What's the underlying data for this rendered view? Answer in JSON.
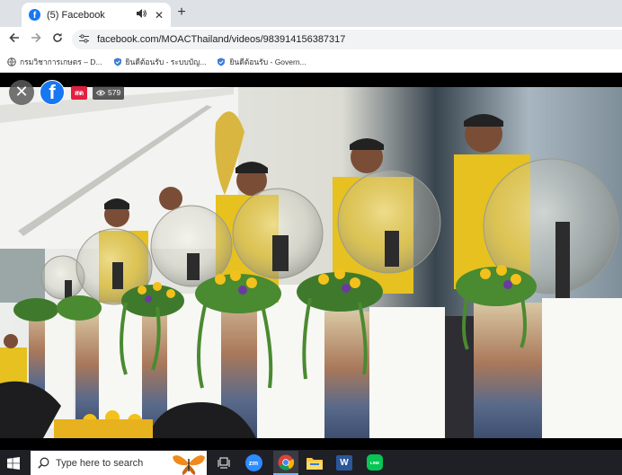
{
  "browser": {
    "tab": {
      "favicon": "facebook-icon",
      "title": "(5) Facebook",
      "audio_icon": "speaker-icon",
      "close_icon": "close-icon"
    },
    "new_tab_icon": "plus-icon",
    "nav": {
      "back_icon": "arrow-left-icon",
      "forward_icon": "arrow-right-icon",
      "reload_icon": "reload-icon",
      "site_info_icon": "tune-icon"
    },
    "address": {
      "url": "facebook.com/MOACThailand/videos/983914156387317"
    },
    "bookmarks": [
      {
        "label": "กรมวิชาการเกษตร – D...",
        "icon": "globe-icon"
      },
      {
        "label": "ยินดีต้อนรับ - ระบบบัญ...",
        "icon": "shield-icon"
      },
      {
        "label": "ยินดีต้อนรับ - Govern...",
        "icon": "shield-icon"
      }
    ]
  },
  "video_overlay": {
    "close_icon": "close-icon",
    "page_logo": "facebook-logo",
    "live_badge": "สด",
    "view_count": "579",
    "eye_icon": "eye-icon"
  },
  "taskbar": {
    "start_icon": "windows-icon",
    "search_placeholder": "Type here to search",
    "apps": [
      "task-view-icon",
      "zoom-icon",
      "chrome-icon",
      "file-explorer-icon",
      "word-icon",
      "line-icon"
    ],
    "zoom_label": "zm",
    "word_label": "W",
    "line_label": "LINE"
  },
  "colors": {
    "facebook_blue": "#1877f2",
    "live_red": "#e41e3f",
    "taskbar_bg": "#1f1f26",
    "tabbar_bg": "#dee1e6"
  }
}
